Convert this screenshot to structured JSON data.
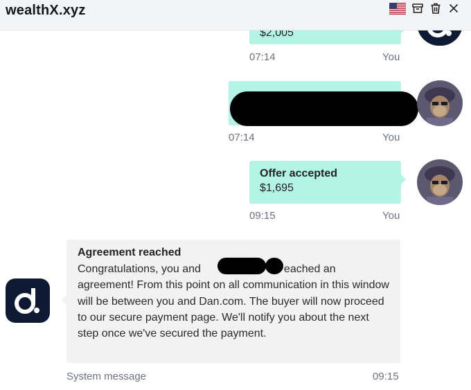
{
  "app": {
    "title": "wealthX.xyz"
  },
  "toolbar": {
    "flag_icon": "us-flag-icon",
    "archive_icon": "archive-icon",
    "delete_icon": "trash-icon",
    "close_icon": "close-icon"
  },
  "messages": [
    {
      "from": "You",
      "title": "",
      "value": "$2,005",
      "time": "07:14",
      "sender_label": "You"
    },
    {
      "from": "You",
      "redacted": true,
      "time": "07:14",
      "sender_label": "You"
    },
    {
      "from": "You",
      "title": "Offer accepted",
      "value": "$1,695",
      "time": "09:15",
      "sender_label": "You"
    },
    {
      "from": "System",
      "title": "Agreement reached",
      "body": "Congratulations, you and                           eached an agreement! From this point on all communication in this window will be between you and Dan.com. The buyer will now proceed to our secure payment page. We'll notify you about the next step once we've secured the payment.",
      "time": "09:15",
      "sender_label": "System message"
    }
  ],
  "colors": {
    "mint": "#b3f4e6",
    "gray_bubble": "#f2f2f3",
    "dan_navy": "#0e1a33"
  }
}
